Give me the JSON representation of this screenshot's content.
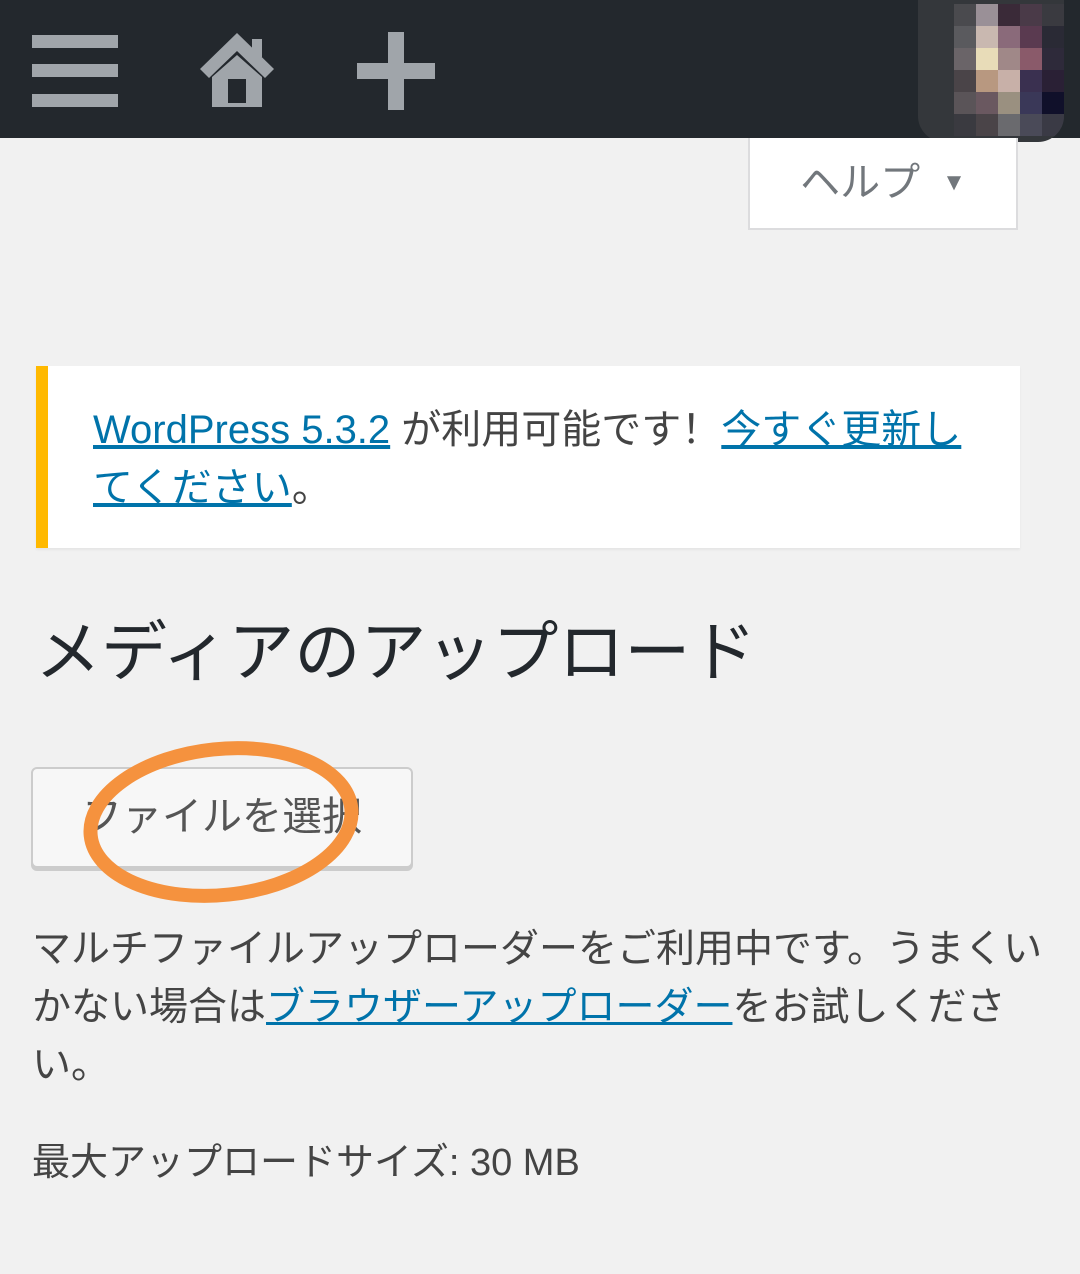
{
  "admin_bar": {
    "menu_icon": "menu-icon",
    "home_icon": "home-icon",
    "new_content_icon": "plus-icon"
  },
  "help_tab": {
    "label": "ヘルプ",
    "arrow": "▼"
  },
  "notice": {
    "version_link": "WordPress 5.3.2",
    "message": " が利用可能です！",
    "update_link": "今すぐ更新してください",
    "end": "。"
  },
  "page_title": "メディアのアップロード",
  "upload": {
    "select_button": "ファイルを選択",
    "info_prefix": "マルチファイルアップローダーをご利用中です。うまくいかない場合は",
    "browser_uploader_link": "ブラウザーアップローダー",
    "info_suffix": "をお試しください。",
    "max_size": "最大アップロードサイズ: 30 MB"
  },
  "colors": {
    "admin_bar_bg": "#23282d",
    "admin_icon": "#a0a5aa",
    "page_bg": "#f1f1f1",
    "notice_border": "#ffb900",
    "link": "#0073aa",
    "annotation": "#f5923e"
  }
}
